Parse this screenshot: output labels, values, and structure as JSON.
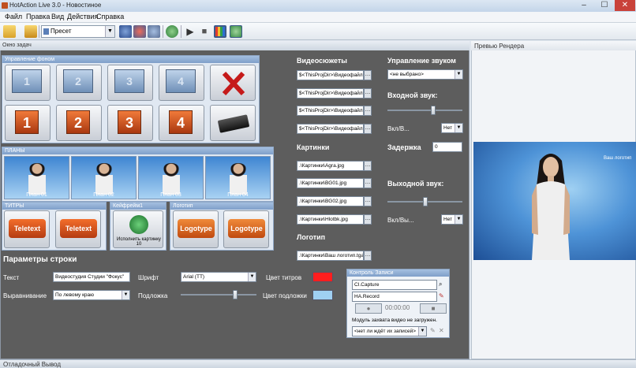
{
  "window": {
    "title": "HotAction Live 3.0 - Новостиное"
  },
  "menu": [
    "Файл",
    "Правка",
    "Вид",
    "Действия",
    "Справка"
  ],
  "toolbar": {
    "preset": "Пресет"
  },
  "left_panel": {
    "header": "Окно задач"
  },
  "sections": {
    "backgrounds": "Управление фоном",
    "plans": "ПЛАНЫ",
    "titles": "ТИТРЫ",
    "keyframe": "Кейфрейм1",
    "logotype": "Логотип"
  },
  "background_tiles": {
    "film": [
      "1",
      "2",
      "3",
      "4"
    ],
    "numbers": [
      "1",
      "2",
      "3",
      "4"
    ]
  },
  "plans": [
    "План 01",
    "План 02",
    "План 03",
    "План 04"
  ],
  "titles": [
    "Teletext",
    "Teletext"
  ],
  "keyframe": {
    "label": "Исполнить картинку 10"
  },
  "logos": [
    "Logotype",
    "Logotype"
  ],
  "video": {
    "heading": "Видеосюжеты",
    "files": [
      "$<ThisProjDir>\\Видеофайлы\\",
      "$<ThisProjDir>\\Видеофайлы\\",
      "$<ThisProjDir>\\Видеофайлы\\",
      "$<ThisProjDir>\\Видеофайлы\\"
    ]
  },
  "pictures": {
    "heading": "Картинки",
    "files": [
      ".\\Картинки\\Agra.jpg",
      ".\\Картинки\\BG01.jpg",
      ".\\Картинки\\BG02.jpg",
      ".\\Картинки\\Hlotbk.jpg"
    ]
  },
  "logo": {
    "heading": "Логотип",
    "file": ".\\Картинки\\Ваш логотип.tga"
  },
  "sound": {
    "heading": "Управление звуком",
    "device": "<не выбрано>",
    "input_label": "Входной звук:",
    "input_level": 0.62,
    "onoff1_label": "Вкл/В...",
    "onoff1_value": "Нет",
    "delay_label": "Задержка",
    "delay_value": "0",
    "output_label": "Выходной звук:",
    "output_level": 0.5,
    "onoff2_label": "Вкл/Вы...",
    "onoff2_value": "Нет"
  },
  "string_params": {
    "heading": "Параметры строки",
    "text_label": "Текст",
    "text_value": "Видеостудия Студии \"Фокус\"",
    "font_label": "Шрифт",
    "font_value": "Arial (TT)",
    "title_color_label": "Цвет титров",
    "title_color": "#ff1e1e",
    "align_label": "Выравнивание",
    "align_value": "По левому краю",
    "substrate_label": "Подложка",
    "substrate_level": 0.73,
    "substrate_color_label": "Цвет подложки",
    "substrate_color": "#9fd0f2"
  },
  "capture": {
    "header": "Контроль Записи",
    "device": "CI.Capture",
    "record": "HA.Record",
    "time": "00:00:00",
    "status": "Модуль захвата видео не загружен.",
    "list": "<нет ли ждёт их записей>"
  },
  "preview": {
    "header": "Превью Рендера",
    "logo_text": "Ваш логотип"
  },
  "status": {
    "text": "Отладочный Вывод"
  }
}
